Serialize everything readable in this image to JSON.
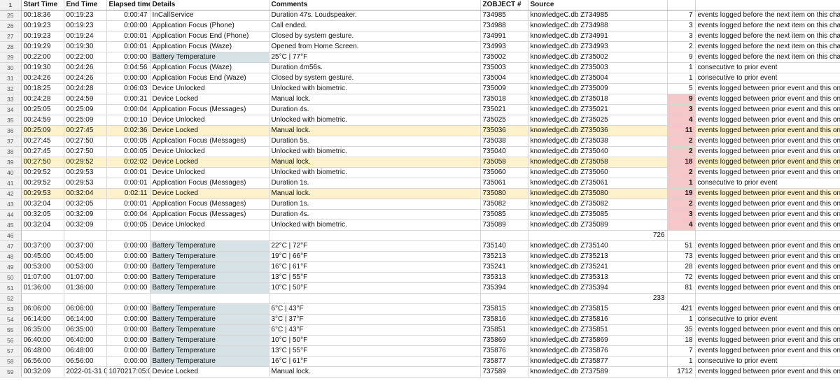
{
  "columns": [
    "Start Time",
    "End Time",
    "Elapsed time",
    "Details",
    "Comments",
    "ZOBJECT #",
    "Source",
    "",
    ""
  ],
  "rows": [
    {
      "n": "1",
      "type": "header"
    },
    {
      "n": "25",
      "c": [
        "00:18:36",
        "00:19:23",
        "0:00:47",
        "InCallService",
        "Duration 47s. Loudspeaker.",
        "734985",
        "knowledgeC.db Z734985",
        "7",
        "events logged before the next item on this chart."
      ]
    },
    {
      "n": "26",
      "c": [
        "00:19:23",
        "00:19:23",
        "0:00:00",
        "Application Focus (Phone)",
        "Call ended.",
        "734988",
        "knowledgeC.db Z734988",
        "3",
        "events logged before the next item on this chart."
      ]
    },
    {
      "n": "27",
      "c": [
        "00:19:23",
        "00:19:24",
        "0:00:01",
        "Application Focus End (Phone)",
        "Closed by system gesture.",
        "734991",
        "knowledgeC.db Z734991",
        "3",
        "events logged before the next item on this chart."
      ]
    },
    {
      "n": "28",
      "c": [
        "00:19:29",
        "00:19:30",
        "0:00:01",
        "Application Focus (Waze)",
        "Opened from Home Screen.",
        "734993",
        "knowledgeC.db Z734993",
        "2",
        "events logged before the next item on this chart."
      ]
    },
    {
      "n": "29",
      "batt": true,
      "c": [
        "00:22:00",
        "00:22:00",
        "0:00:00",
        "Battery Temperature",
        "25°C | 77°F",
        "735002",
        "knowledgeC.db Z735002",
        "9",
        "events logged before the next item on this chart."
      ]
    },
    {
      "n": "30",
      "c": [
        "00:19:30",
        "00:24:26",
        "0:04:56",
        "Application Focus (Waze)",
        "Duration 4m56s.",
        "735003",
        "knowledgeC.db Z735003",
        "1",
        "consecutive to prior event"
      ]
    },
    {
      "n": "31",
      "c": [
        "00:24:26",
        "00:24:26",
        "0:00:00",
        "Application Focus End (Waze)",
        "Closed by system gesture.",
        "735004",
        "knowledgeC.db Z735004",
        "1",
        "consecutive to prior event"
      ]
    },
    {
      "n": "32",
      "c": [
        "00:18:25",
        "00:24:28",
        "0:06:03",
        "Device Unlocked",
        "Unlocked with biometric.",
        "735009",
        "knowledgeC.db Z735009",
        "5",
        "events logged between prior event and this one."
      ]
    },
    {
      "n": "33",
      "pink": true,
      "c": [
        "00:24:28",
        "00:24:59",
        "0:00:31",
        "Device Locked",
        "Manual lock.",
        "735018",
        "knowledgeC.db Z735018",
        "9",
        "events logged between prior event and this one."
      ]
    },
    {
      "n": "34",
      "pink": true,
      "c": [
        "00:25:05",
        "00:25:09",
        "0:00:04",
        "Application Focus (Messages)",
        "Duration 4s.",
        "735021",
        "knowledgeC.db Z735021",
        "3",
        "events logged between prior event and this one."
      ]
    },
    {
      "n": "35",
      "pink": true,
      "c": [
        "00:24:59",
        "00:25:09",
        "0:00:10",
        "Device Unlocked",
        "Unlocked with biometric.",
        "735025",
        "knowledgeC.db Z735025",
        "4",
        "events logged between prior event and this one."
      ]
    },
    {
      "n": "36",
      "hl": true,
      "pink": true,
      "c": [
        "00:25:09",
        "00:27:45",
        "0:02:36",
        "Device Locked",
        "Manual lock.",
        "735036",
        "knowledgeC.db Z735036",
        "11",
        "events logged between prior event and this one."
      ]
    },
    {
      "n": "37",
      "pink": true,
      "c": [
        "00:27:45",
        "00:27:50",
        "0:00:05",
        "Application Focus (Messages)",
        "Duration 5s.",
        "735038",
        "knowledgeC.db Z735038",
        "2",
        "events logged between prior event and this one."
      ]
    },
    {
      "n": "38",
      "pink": true,
      "c": [
        "00:27:45",
        "00:27:50",
        "0:00:05",
        "Device Unlocked",
        "Unlocked with biometric.",
        "735040",
        "knowledgeC.db Z735040",
        "2",
        "events logged between prior event and this one."
      ]
    },
    {
      "n": "39",
      "hl": true,
      "pink": true,
      "c": [
        "00:27:50",
        "00:29:52",
        "0:02:02",
        "Device Locked",
        "Manual lock.",
        "735058",
        "knowledgeC.db Z735058",
        "18",
        "events logged between prior event and this one."
      ]
    },
    {
      "n": "40",
      "pink": true,
      "c": [
        "00:29:52",
        "00:29:53",
        "0:00:01",
        "Device Unlocked",
        "Unlocked with biometric.",
        "735060",
        "knowledgeC.db Z735060",
        "2",
        "events logged between prior event and this one."
      ]
    },
    {
      "n": "41",
      "pink": true,
      "c": [
        "00:29:52",
        "00:29:53",
        "0:00:01",
        "Application Focus (Messages)",
        "Duration 1s.",
        "735061",
        "knowledgeC.db Z735061",
        "1",
        "consecutive to prior event"
      ]
    },
    {
      "n": "42",
      "hl": true,
      "pink": true,
      "c": [
        "00:29:53",
        "00:32:04",
        "0:02:11",
        "Device Locked",
        "Manual lock.",
        "735080",
        "knowledgeC.db Z735080",
        "19",
        "events logged between prior event and this one."
      ]
    },
    {
      "n": "43",
      "pink": true,
      "c": [
        "00:32:04",
        "00:32:05",
        "0:00:01",
        "Application Focus (Messages)",
        "Duration 1s.",
        "735082",
        "knowledgeC.db Z735082",
        "2",
        "events logged between prior event and this one."
      ]
    },
    {
      "n": "44",
      "pink": true,
      "c": [
        "00:32:05",
        "00:32:09",
        "0:00:04",
        "Application Focus (Messages)",
        "Duration 4s.",
        "735085",
        "knowledgeC.db Z735085",
        "3",
        "events logged between prior event and this one."
      ]
    },
    {
      "n": "45",
      "pink": true,
      "c": [
        "00:32:04",
        "00:32:09",
        "0:00:05",
        "Device Unlocked",
        "Unlocked with biometric.",
        "735089",
        "knowledgeC.db Z735089",
        "4",
        "events logged between prior event and this one."
      ]
    },
    {
      "n": "46",
      "type": "gap",
      "total": "726"
    },
    {
      "n": "47",
      "batt": true,
      "c": [
        "00:37:00",
        "00:37:00",
        "0:00:00",
        "Battery Temperature",
        "22°C | 72°F",
        "735140",
        "knowledgeC.db Z735140",
        "51",
        "events logged between prior event and this one."
      ]
    },
    {
      "n": "48",
      "batt": true,
      "c": [
        "00:45:00",
        "00:45:00",
        "0:00:00",
        "Battery Temperature",
        "19°C | 66°F",
        "735213",
        "knowledgeC.db Z735213",
        "73",
        "events logged between prior event and this one."
      ]
    },
    {
      "n": "49",
      "batt": true,
      "c": [
        "00:53:00",
        "00:53:00",
        "0:00:00",
        "Battery Temperature",
        "16°C | 61°F",
        "735241",
        "knowledgeC.db Z735241",
        "28",
        "events logged between prior event and this one."
      ]
    },
    {
      "n": "50",
      "batt": true,
      "c": [
        "01:07:00",
        "01:07:00",
        "0:00:00",
        "Battery Temperature",
        "13°C | 55°F",
        "735313",
        "knowledgeC.db Z735313",
        "72",
        "events logged between prior event and this one."
      ]
    },
    {
      "n": "51",
      "batt": true,
      "c": [
        "01:36:00",
        "01:36:00",
        "0:00:00",
        "Battery Temperature",
        "10°C | 50°F",
        "735394",
        "knowledgeC.db Z735394",
        "81",
        "events logged between prior event and this one."
      ]
    },
    {
      "n": "52",
      "type": "gap",
      "total": "233"
    },
    {
      "n": "53",
      "batt": true,
      "c": [
        "06:06:00",
        "06:06:00",
        "0:00:00",
        "Battery Temperature",
        "6°C | 43°F",
        "735815",
        "knowledgeC.db Z735815",
        "421",
        "events logged between prior event and this one."
      ]
    },
    {
      "n": "54",
      "batt": true,
      "c": [
        "06:14:00",
        "06:14:00",
        "0:00:00",
        "Battery Temperature",
        "3°C | 37°F",
        "735816",
        "knowledgeC.db Z735816",
        "1",
        "consecutive to prior event"
      ]
    },
    {
      "n": "55",
      "batt": true,
      "c": [
        "06:35:00",
        "06:35:00",
        "0:00:00",
        "Battery Temperature",
        "6°C | 43°F",
        "735851",
        "knowledgeC.db Z735851",
        "35",
        "events logged between prior event and this one."
      ]
    },
    {
      "n": "56",
      "batt": true,
      "c": [
        "06:40:00",
        "06:40:00",
        "0:00:00",
        "Battery Temperature",
        "10°C | 50°F",
        "735869",
        "knowledgeC.db Z735869",
        "18",
        "events logged between prior event and this one."
      ]
    },
    {
      "n": "57",
      "batt": true,
      "c": [
        "06:48:00",
        "06:48:00",
        "0:00:00",
        "Battery Temperature",
        "13°C | 55°F",
        "735876",
        "knowledgeC.db Z735876",
        "7",
        "events logged between prior event and this one."
      ]
    },
    {
      "n": "58",
      "batt": true,
      "c": [
        "06:56:00",
        "06:56:00",
        "0:00:00",
        "Battery Temperature",
        "16°C | 61°F",
        "735877",
        "knowledgeC.db Z735877",
        "1",
        "consecutive to prior event"
      ]
    },
    {
      "n": "59",
      "c": [
        "00:32:09",
        "2022-01-31 0",
        "1070217:05:0",
        "Device Locked",
        "Manual lock.",
        "737589",
        "knowledgeC.db Z737589",
        "1712",
        "events logged between prior event and this one."
      ]
    }
  ],
  "colors": {
    "highlight_row": "#fdf2cc",
    "count_flag": "#f4c7c9",
    "battery_cell": "#d7e2e6"
  }
}
